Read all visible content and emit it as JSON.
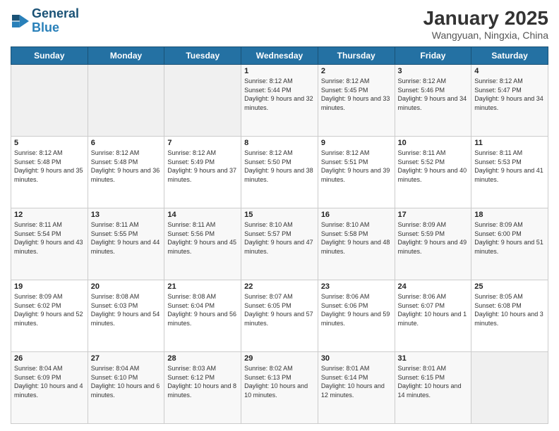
{
  "logo": {
    "line1": "General",
    "line2": "Blue"
  },
  "title": "January 2025",
  "subtitle": "Wangyuan, Ningxia, China",
  "weekdays": [
    "Sunday",
    "Monday",
    "Tuesday",
    "Wednesday",
    "Thursday",
    "Friday",
    "Saturday"
  ],
  "weeks": [
    [
      {
        "day": "",
        "info": ""
      },
      {
        "day": "",
        "info": ""
      },
      {
        "day": "",
        "info": ""
      },
      {
        "day": "1",
        "info": "Sunrise: 8:12 AM\nSunset: 5:44 PM\nDaylight: 9 hours and 32 minutes."
      },
      {
        "day": "2",
        "info": "Sunrise: 8:12 AM\nSunset: 5:45 PM\nDaylight: 9 hours and 33 minutes."
      },
      {
        "day": "3",
        "info": "Sunrise: 8:12 AM\nSunset: 5:46 PM\nDaylight: 9 hours and 34 minutes."
      },
      {
        "day": "4",
        "info": "Sunrise: 8:12 AM\nSunset: 5:47 PM\nDaylight: 9 hours and 34 minutes."
      }
    ],
    [
      {
        "day": "5",
        "info": "Sunrise: 8:12 AM\nSunset: 5:48 PM\nDaylight: 9 hours and 35 minutes."
      },
      {
        "day": "6",
        "info": "Sunrise: 8:12 AM\nSunset: 5:48 PM\nDaylight: 9 hours and 36 minutes."
      },
      {
        "day": "7",
        "info": "Sunrise: 8:12 AM\nSunset: 5:49 PM\nDaylight: 9 hours and 37 minutes."
      },
      {
        "day": "8",
        "info": "Sunrise: 8:12 AM\nSunset: 5:50 PM\nDaylight: 9 hours and 38 minutes."
      },
      {
        "day": "9",
        "info": "Sunrise: 8:12 AM\nSunset: 5:51 PM\nDaylight: 9 hours and 39 minutes."
      },
      {
        "day": "10",
        "info": "Sunrise: 8:11 AM\nSunset: 5:52 PM\nDaylight: 9 hours and 40 minutes."
      },
      {
        "day": "11",
        "info": "Sunrise: 8:11 AM\nSunset: 5:53 PM\nDaylight: 9 hours and 41 minutes."
      }
    ],
    [
      {
        "day": "12",
        "info": "Sunrise: 8:11 AM\nSunset: 5:54 PM\nDaylight: 9 hours and 43 minutes."
      },
      {
        "day": "13",
        "info": "Sunrise: 8:11 AM\nSunset: 5:55 PM\nDaylight: 9 hours and 44 minutes."
      },
      {
        "day": "14",
        "info": "Sunrise: 8:11 AM\nSunset: 5:56 PM\nDaylight: 9 hours and 45 minutes."
      },
      {
        "day": "15",
        "info": "Sunrise: 8:10 AM\nSunset: 5:57 PM\nDaylight: 9 hours and 47 minutes."
      },
      {
        "day": "16",
        "info": "Sunrise: 8:10 AM\nSunset: 5:58 PM\nDaylight: 9 hours and 48 minutes."
      },
      {
        "day": "17",
        "info": "Sunrise: 8:09 AM\nSunset: 5:59 PM\nDaylight: 9 hours and 49 minutes."
      },
      {
        "day": "18",
        "info": "Sunrise: 8:09 AM\nSunset: 6:00 PM\nDaylight: 9 hours and 51 minutes."
      }
    ],
    [
      {
        "day": "19",
        "info": "Sunrise: 8:09 AM\nSunset: 6:02 PM\nDaylight: 9 hours and 52 minutes."
      },
      {
        "day": "20",
        "info": "Sunrise: 8:08 AM\nSunset: 6:03 PM\nDaylight: 9 hours and 54 minutes."
      },
      {
        "day": "21",
        "info": "Sunrise: 8:08 AM\nSunset: 6:04 PM\nDaylight: 9 hours and 56 minutes."
      },
      {
        "day": "22",
        "info": "Sunrise: 8:07 AM\nSunset: 6:05 PM\nDaylight: 9 hours and 57 minutes."
      },
      {
        "day": "23",
        "info": "Sunrise: 8:06 AM\nSunset: 6:06 PM\nDaylight: 9 hours and 59 minutes."
      },
      {
        "day": "24",
        "info": "Sunrise: 8:06 AM\nSunset: 6:07 PM\nDaylight: 10 hours and 1 minute."
      },
      {
        "day": "25",
        "info": "Sunrise: 8:05 AM\nSunset: 6:08 PM\nDaylight: 10 hours and 3 minutes."
      }
    ],
    [
      {
        "day": "26",
        "info": "Sunrise: 8:04 AM\nSunset: 6:09 PM\nDaylight: 10 hours and 4 minutes."
      },
      {
        "day": "27",
        "info": "Sunrise: 8:04 AM\nSunset: 6:10 PM\nDaylight: 10 hours and 6 minutes."
      },
      {
        "day": "28",
        "info": "Sunrise: 8:03 AM\nSunset: 6:12 PM\nDaylight: 10 hours and 8 minutes."
      },
      {
        "day": "29",
        "info": "Sunrise: 8:02 AM\nSunset: 6:13 PM\nDaylight: 10 hours and 10 minutes."
      },
      {
        "day": "30",
        "info": "Sunrise: 8:01 AM\nSunset: 6:14 PM\nDaylight: 10 hours and 12 minutes."
      },
      {
        "day": "31",
        "info": "Sunrise: 8:01 AM\nSunset: 6:15 PM\nDaylight: 10 hours and 14 minutes."
      },
      {
        "day": "",
        "info": ""
      }
    ]
  ]
}
